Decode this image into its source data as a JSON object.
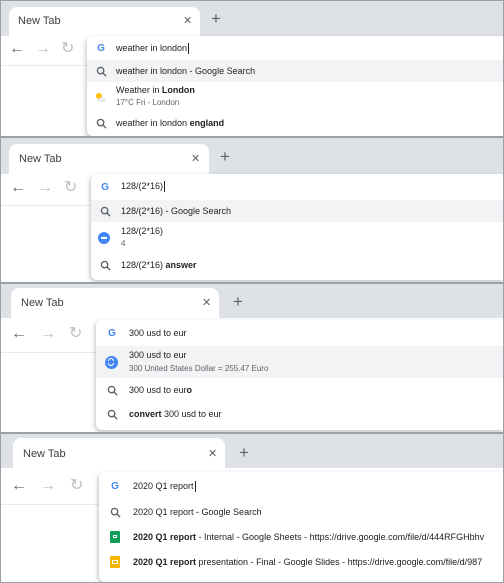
{
  "browser": {
    "tab_title": "New Tab",
    "tab_close": "✕",
    "new_tab": "+",
    "back": "←",
    "forward": "→",
    "reload": "↻"
  },
  "panels": [
    {
      "query": "weather in london",
      "suggestions": [
        {
          "icon": "search-icon",
          "text": "weather in london - Google Search",
          "highlighted": true
        },
        {
          "icon": "weather-icon",
          "line1_pre": "Weather in ",
          "line1_bold": "London",
          "line2": "17°C Fri - London"
        },
        {
          "icon": "search-icon",
          "pre": "weather in london ",
          "bold": "england"
        }
      ]
    },
    {
      "query": "128/(2*16)",
      "suggestions": [
        {
          "icon": "search-icon",
          "text": "128/(2*16) - Google Search",
          "highlighted": true
        },
        {
          "icon": "calculator-icon",
          "line1": "128/(2*16)",
          "line2": "4"
        },
        {
          "icon": "search-icon",
          "pre": "128/(2*16) ",
          "bold": "answer"
        }
      ]
    },
    {
      "query": "300 usd to eur",
      "suggestions": [
        {
          "icon": "currency-icon",
          "line1": "300 usd to eur",
          "line2": "300 United States Dollar = 255.47 Euro",
          "highlighted": true
        },
        {
          "icon": "search-icon",
          "pre": "300 usd to eur",
          "bold": "o"
        },
        {
          "icon": "search-icon",
          "bold_pre": "convert",
          "post": " 300 usd to eur"
        }
      ]
    },
    {
      "query": "2020 Q1 report",
      "suggestions": [
        {
          "icon": "search-icon",
          "text": "2020 Q1 report - Google Search"
        },
        {
          "icon": "sheets-icon",
          "bold": "2020 Q1 report",
          "post": " - Internal - Google Sheets - https://drive.google.com/file/d/444RFGHbhv"
        },
        {
          "icon": "slides-icon",
          "bold": "2020 Q1 report",
          "post": " presentation - Final - Google Slides - https://drive.google.com/file/d/987"
        }
      ]
    }
  ]
}
